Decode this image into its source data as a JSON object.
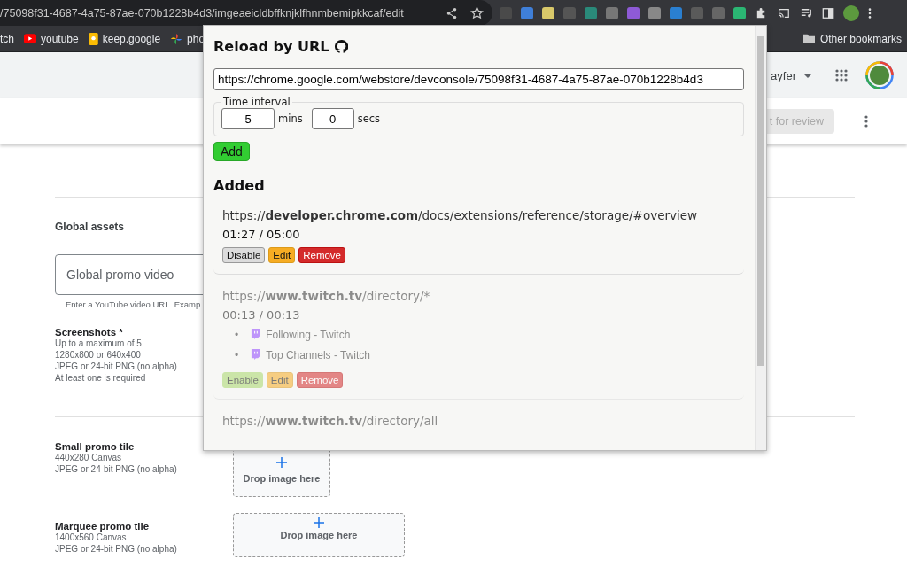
{
  "browser": {
    "address": "/75098f31-4687-4a75-87ae-070b1228b4d3/imgeaeicldbffknjklfhnmbemipkkcaf/edit",
    "bookmarks": [
      {
        "label": "tch",
        "kind": "cut"
      },
      {
        "label": "youtube",
        "kind": "youtube"
      },
      {
        "label": "keep.google",
        "kind": "keep"
      },
      {
        "label": "pho",
        "kind": "photos"
      }
    ],
    "other_bookmarks": "Other bookmarks"
  },
  "page": {
    "account": "ayfer",
    "submit_button": "t for review",
    "global_assets": {
      "title": "Global assets",
      "video_field": {
        "placeholder": "Global promo video"
      },
      "hint": "Enter a YouTube video URL. Examp"
    },
    "screenshots": {
      "title": "Screenshots *",
      "lines": [
        "Up to a maximum of 5",
        "1280x800 or 640x400",
        "JPEG or 24-bit PNG (no alpha)",
        "At least one is required"
      ]
    },
    "tiles": [
      {
        "title": "Small promo tile",
        "lines": [
          "440x280 Canvas",
          "JPEG or 24-bit PNG (no alpha)"
        ],
        "drop_label": "Drop image here",
        "kind": "small"
      },
      {
        "title": "Marquee promo tile",
        "lines": [
          "1400x560 Canvas",
          "JPEG or 24-bit PNG (no alpha)"
        ],
        "drop_label": "Drop image here",
        "kind": "wide"
      }
    ]
  },
  "popup": {
    "title": "Reload by URL",
    "url_input": {
      "value": "https://chrome.google.com/webstore/devconsole/75098f31-4687-4a75-87ae-070b1228b4d3"
    },
    "interval": {
      "legend": "Time interval",
      "minutes": "5",
      "minutes_unit": "mins",
      "seconds": "0",
      "seconds_unit": "secs"
    },
    "add_button": "Add",
    "added_heading": "Added",
    "entries": [
      {
        "url": "https://**developer.chrome.com**/docs/extensions/reference/storage/#overview",
        "time": "01:27 / 05:00",
        "enabled": true,
        "actions": [
          {
            "label": "Disable",
            "kind": "toggle"
          },
          {
            "label": "Edit",
            "kind": "edit"
          },
          {
            "label": "Remove",
            "kind": "remove"
          }
        ]
      },
      {
        "url": "https://**www.twitch.tv**/directory/*",
        "time": "00:13 / 00:13",
        "enabled": false,
        "tabs": [
          {
            "bullet": "•",
            "title": "Following - Twitch"
          },
          {
            "bullet": "•",
            "title": "Top Channels - Twitch"
          }
        ],
        "actions": [
          {
            "label": "Enable",
            "kind": "toggle"
          },
          {
            "label": "Edit",
            "kind": "edit"
          },
          {
            "label": "Remove",
            "kind": "remove"
          }
        ]
      },
      {
        "url": "https://**www.twitch.tv**/directory/all",
        "enabled": false
      }
    ]
  }
}
